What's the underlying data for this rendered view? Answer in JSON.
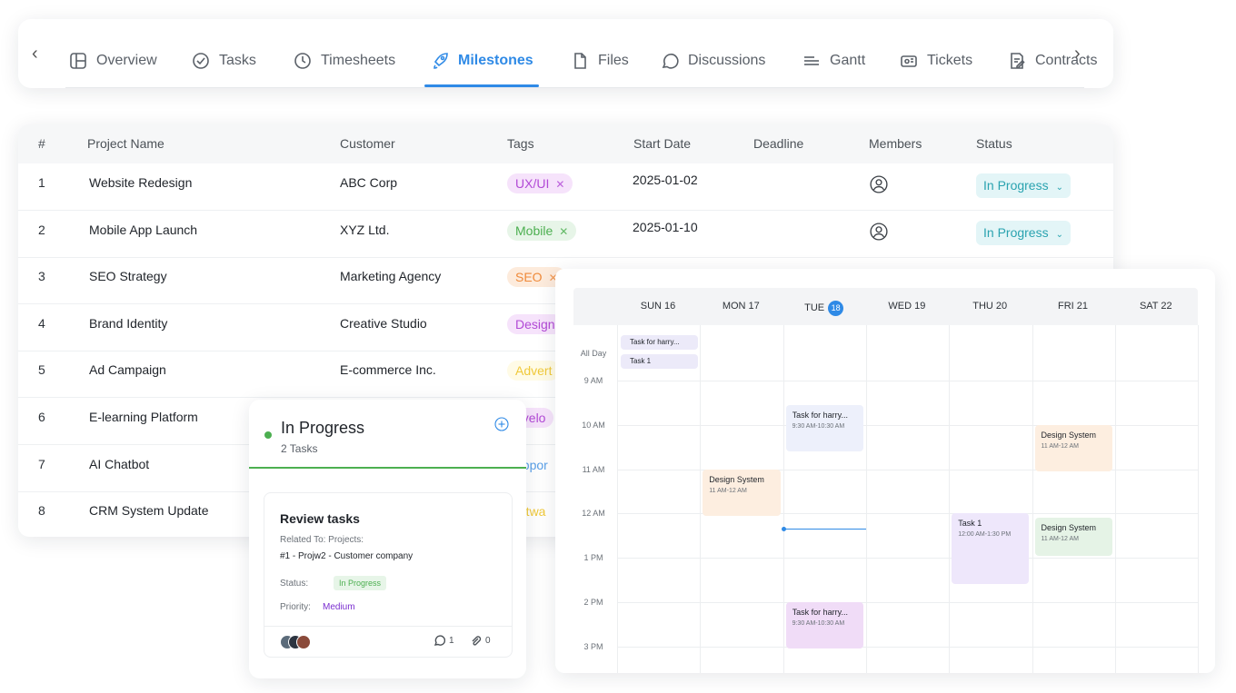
{
  "tabs": {
    "prev_arrow": "‹",
    "next_arrow": "›",
    "items": [
      {
        "label": "Overview",
        "icon": "layout-icon"
      },
      {
        "label": "Tasks",
        "icon": "tasks-icon"
      },
      {
        "label": "Timesheets",
        "icon": "clock-icon"
      },
      {
        "label": "Milestones",
        "icon": "rocket-icon",
        "active": true
      },
      {
        "label": "Files",
        "icon": "file-icon"
      },
      {
        "label": "Discussions",
        "icon": "chat-icon"
      },
      {
        "label": "Gantt",
        "icon": "gantt-icon"
      },
      {
        "label": "Tickets",
        "icon": "ticket-icon"
      },
      {
        "label": "Contracts",
        "icon": "contract-icon"
      }
    ]
  },
  "table": {
    "headers": {
      "num": "#",
      "project_name": "Project Name",
      "customer": "Customer",
      "tags": "Tags",
      "start_date": "Start Date",
      "deadline": "Deadline",
      "members": "Members",
      "status": "Status"
    },
    "rows": [
      {
        "num": "1",
        "project_name": "Website Redesign",
        "customer": "ABC Corp",
        "tag": "UX/UI",
        "tag_bg": "#f6e3fb",
        "tag_color": "#b24ad6",
        "start_date": "2025-01-02",
        "deadline": "",
        "status": "In Progress"
      },
      {
        "num": "2",
        "project_name": "Mobile App Launch",
        "customer": "XYZ Ltd.",
        "tag": "Mobile",
        "tag_bg": "#e7f5e8",
        "tag_color": "#4caf50",
        "start_date": "2025-01-10",
        "deadline": "",
        "status": "In Progress"
      },
      {
        "num": "3",
        "project_name": "SEO Strategy",
        "customer": "Marketing Agency",
        "tag": "SEO",
        "tag_bg": "#fdebdc",
        "tag_color": "#ef8a3a",
        "start_date": "",
        "deadline": "",
        "status": ""
      },
      {
        "num": "4",
        "project_name": "Brand Identity",
        "customer": "Creative Studio",
        "tag": "Design",
        "tag_bg": "#f6e3fb",
        "tag_color": "#b24ad6",
        "start_date": "",
        "deadline": "",
        "status": ""
      },
      {
        "num": "5",
        "project_name": "Ad Campaign",
        "customer": "E-commerce Inc.",
        "tag": "Advert",
        "tag_bg": "#fffbe6",
        "tag_color": "#f0c93a",
        "start_date": "",
        "deadline": "",
        "status": ""
      },
      {
        "num": "6",
        "project_name": "E-learning Platform",
        "customer": "",
        "tag": "evelo",
        "tag_bg": "#f6e3fb",
        "tag_color": "#b24ad6",
        "start_date": "",
        "deadline": "",
        "status": ""
      },
      {
        "num": "7",
        "project_name": "AI Chatbot",
        "customer": "",
        "tag": "uppor",
        "tag_bg": "#ffffff",
        "tag_color": "#5aa0e8",
        "start_date": "",
        "deadline": "",
        "status": ""
      },
      {
        "num": "8",
        "project_name": "CRM System Update",
        "customer": "",
        "tag": "oftwa",
        "tag_bg": "#ffffff",
        "tag_color": "#f0c93a",
        "start_date": "",
        "deadline": "",
        "status": ""
      }
    ]
  },
  "calendar": {
    "days": [
      {
        "label": "SUN 16"
      },
      {
        "label": "MON 17"
      },
      {
        "label": "TUE",
        "badge": "18"
      },
      {
        "label": "WED 19"
      },
      {
        "label": "THU 20"
      },
      {
        "label": "FRI 21"
      },
      {
        "label": "SAT 22"
      }
    ],
    "all_day_label": "All Day",
    "times": [
      "9 AM",
      "10 AM",
      "11 AM",
      "12 AM",
      "1 PM",
      "2 PM",
      "3 PM"
    ],
    "all_day_events": [
      {
        "title": "Task for harry..."
      },
      {
        "title": "Task 1"
      }
    ],
    "events": [
      {
        "title": "Task for harry...",
        "time": "9:30 AM-10:30 AM",
        "bg": "#edf0fb"
      },
      {
        "title": "Design System",
        "time": "11 AM-12 AM",
        "bg": "#fdeee0"
      },
      {
        "title": "Design System",
        "time": "11 AM-12 AM",
        "bg": "#fdeee0"
      },
      {
        "title": "Task 1",
        "time": "12:00 AM-1:30 PM",
        "bg": "#eee7fb"
      },
      {
        "title": "Design System",
        "time": "11 AM-12 AM",
        "bg": "#e5f3e6"
      },
      {
        "title": "Task for harry...",
        "time": "9:30 AM-10:30 AM",
        "bg": "#f0dcf7"
      }
    ]
  },
  "kanban": {
    "column_title": "In Progress",
    "count": "2 Tasks",
    "accent": "#4caf50",
    "card": {
      "title": "Review tasks",
      "related_label": "Related To: Projects:",
      "related_value": "#1 - Projw2 - Customer company",
      "status_label": "Status:",
      "status_value": "In Progress",
      "priority_label": "Priority:",
      "priority_value": "Medium",
      "comments": "1",
      "attachments": "0"
    }
  }
}
